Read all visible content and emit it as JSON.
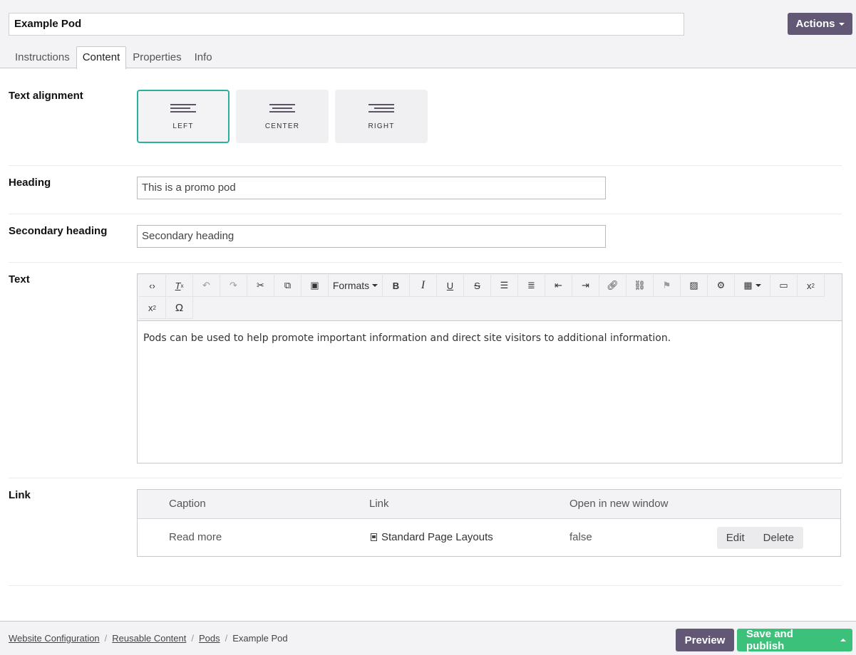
{
  "header": {
    "title_value": "Example Pod",
    "actions_label": "Actions"
  },
  "tabs": [
    {
      "label": "Instructions",
      "active": false
    },
    {
      "label": "Content",
      "active": true
    },
    {
      "label": "Properties",
      "active": false
    },
    {
      "label": "Info",
      "active": false
    }
  ],
  "fields": {
    "text_alignment": {
      "label": "Text alignment",
      "options": [
        {
          "label": "LEFT",
          "selected": true
        },
        {
          "label": "CENTER",
          "selected": false
        },
        {
          "label": "RIGHT",
          "selected": false
        }
      ]
    },
    "heading": {
      "label": "Heading",
      "value": "This is a promo pod"
    },
    "secondary_heading": {
      "label": "Secondary heading",
      "value": "Secondary heading"
    },
    "text": {
      "label": "Text",
      "toolbar_formats_label": "Formats",
      "toolbar_icons": [
        "source-code-icon",
        "clear-format-icon",
        "undo-icon",
        "redo-icon",
        "cut-icon",
        "copy-icon",
        "paste-icon",
        "formats-dropdown",
        "bold-icon",
        "italic-icon",
        "underline-icon",
        "strikethrough-icon",
        "bullet-list-icon",
        "numbered-list-icon",
        "outdent-icon",
        "indent-icon",
        "link-icon",
        "unlink-icon",
        "anchor-icon",
        "image-icon",
        "widget-icon",
        "table-icon",
        "preview-icon",
        "subscript-icon",
        "superscript-icon",
        "special-character-icon"
      ],
      "content": "Pods can be used to help promote important information and direct site visitors to additional information."
    },
    "link": {
      "label": "Link",
      "columns": [
        "Caption",
        "Link",
        "Open in new window"
      ],
      "rows": [
        {
          "caption": "Read more",
          "link": "Standard Page Layouts",
          "open_in_new_window": "false",
          "edit_label": "Edit",
          "delete_label": "Delete"
        }
      ]
    }
  },
  "footer": {
    "breadcrumbs": [
      "Website Configuration",
      "Reusable Content",
      "Pods"
    ],
    "current": "Example Pod",
    "preview_label": "Preview",
    "publish_label": "Save and publish"
  },
  "colors": {
    "primary": "#625775",
    "success": "#3cc17a",
    "selected_border": "#27b39b"
  }
}
